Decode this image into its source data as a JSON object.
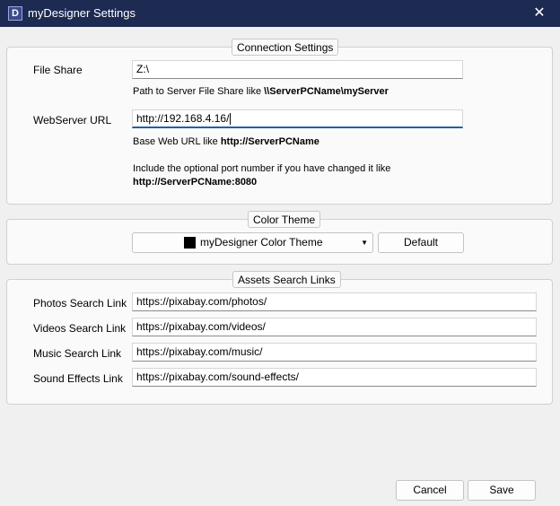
{
  "window": {
    "title": "myDesigner Settings",
    "icon_letter": "D",
    "close_glyph": "✕"
  },
  "connection": {
    "legend": "Connection Settings",
    "file_share_label": "File Share",
    "file_share_value": "Z:\\",
    "file_share_hint_prefix": "Path to Server File Share like ",
    "file_share_hint_bold": "\\\\ServerPCName\\myServer",
    "webserver_label": "WebServer URL",
    "webserver_value": "http://192.168.4.16/",
    "webserver_hint_prefix": "Base Web URL like ",
    "webserver_hint_bold": "http://ServerPCName",
    "port_hint_line1": "Include the optional port number if you have changed it like",
    "port_hint_line2": "http://ServerPCName:8080"
  },
  "theme": {
    "legend": "Color Theme",
    "selected": "myDesigner Color Theme",
    "swatch_color": "#000000",
    "default_button": "Default"
  },
  "assets": {
    "legend": "Assets Search Links",
    "rows": [
      {
        "label": "Photos Search Link",
        "value": "https://pixabay.com/photos/"
      },
      {
        "label": "Videos Search Link",
        "value": "https://pixabay.com/videos/"
      },
      {
        "label": "Music Search Link",
        "value": "https://pixabay.com/music/"
      },
      {
        "label": "Sound Effects Link",
        "value": "https://pixabay.com/sound-effects/"
      }
    ]
  },
  "footer": {
    "cancel_label": "Cancel",
    "save_label": "Save"
  },
  "colors": {
    "titlebar": "#1d2a52",
    "focus_accent": "#1f5fa8",
    "background": "#f0f0f0"
  }
}
